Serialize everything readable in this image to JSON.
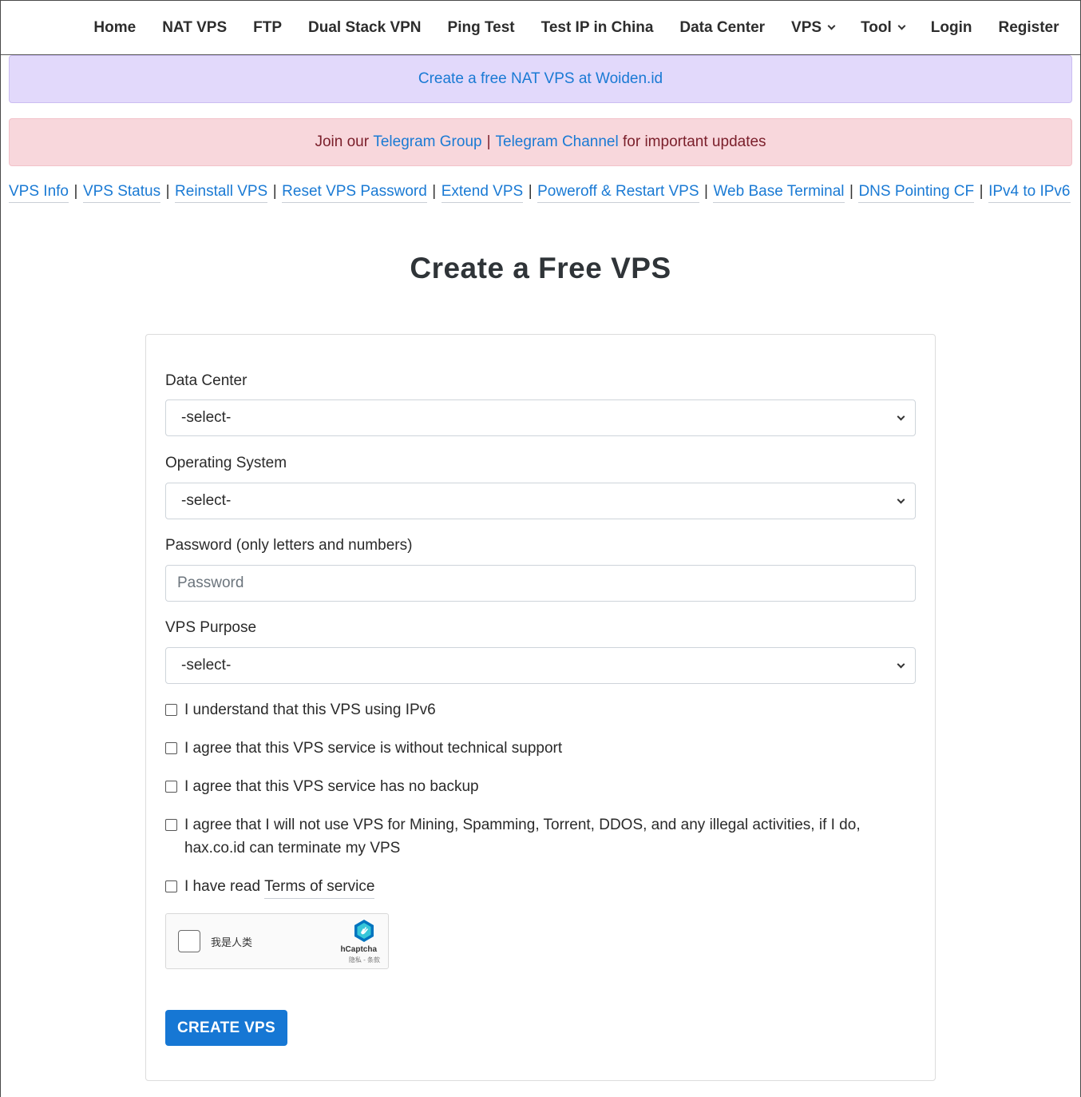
{
  "nav": {
    "items": [
      {
        "label": "Home"
      },
      {
        "label": "NAT VPS"
      },
      {
        "label": "FTP"
      },
      {
        "label": "Dual Stack VPN"
      },
      {
        "label": "Ping Test"
      },
      {
        "label": "Test IP in China"
      },
      {
        "label": "Data Center"
      },
      {
        "label": "VPS"
      },
      {
        "label": "Tool"
      },
      {
        "label": "Login"
      },
      {
        "label": "Register"
      }
    ]
  },
  "banner_nat": {
    "text": "Create a free NAT VPS at Woiden.id"
  },
  "banner_telegram": {
    "prefix": "Join our",
    "group_link": "Telegram Group",
    "separator": "|",
    "channel_link": "Telegram Channel",
    "suffix": "for important updates"
  },
  "sublinks": {
    "separator": "|",
    "items": [
      {
        "label": "VPS Info"
      },
      {
        "label": "VPS Status"
      },
      {
        "label": "Reinstall VPS"
      },
      {
        "label": "Reset VPS Password"
      },
      {
        "label": "Extend VPS"
      },
      {
        "label": "Poweroff & Restart VPS"
      },
      {
        "label": "Web Base Terminal"
      },
      {
        "label": "DNS Pointing CF"
      },
      {
        "label": "IPv4 to IPv6"
      }
    ]
  },
  "page": {
    "title": "Create a Free VPS"
  },
  "form": {
    "datacenter": {
      "label": "Data Center",
      "value": "-select-"
    },
    "os": {
      "label": "Operating System",
      "value": "-select-"
    },
    "password": {
      "label": "Password (only letters and numbers)",
      "placeholder": "Password"
    },
    "purpose": {
      "label": "VPS Purpose",
      "value": "-select-"
    },
    "checks": {
      "ipv6": "I understand that this VPS using IPv6",
      "support": "I agree that this VPS service is without technical support",
      "backup": "I agree that this VPS service has no backup",
      "abuse": "I agree that I will not use VPS for Mining, Spamming, Torrent, DDOS, and any illegal activities, if I do, hax.co.id can terminate my VPS",
      "tos_prefix": "I have read",
      "tos_link": "Terms of service"
    },
    "captcha": {
      "label": "我是人类",
      "brand": "hCaptcha",
      "footer": "隐私 - 条款"
    },
    "submit_label": "CREATE VPS"
  },
  "colors": {
    "link": "#1a7ad4",
    "button": "#1677d4",
    "alert_purple_bg": "#e2d9fb",
    "alert_red_bg": "#f8d7dc"
  }
}
